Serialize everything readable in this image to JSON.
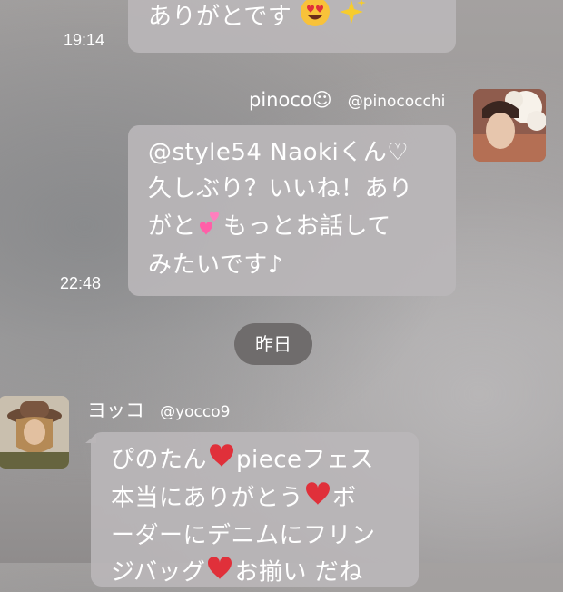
{
  "messages": [
    {
      "text_parts": [
        "ありがとです"
      ],
      "emojis": [
        "heart-eyes-emoji",
        "sparkles-emoji"
      ],
      "time": "19:14"
    },
    {
      "sender_name": "pinoco☺",
      "sender_handle": "@pinococchi",
      "lines": [
        "@style54 Naokiくん♡",
        "久しぶり？いいね！あり",
        "がと",
        "もっとお話して",
        "みたいです♪"
      ],
      "emojis": [
        "two-hearts-emoji"
      ],
      "time": "22:48"
    },
    {
      "sender_name": "ヨッコ",
      "sender_handle": "@yocco9",
      "lines": [
        "ぴのたん",
        "pieceフェス",
        "本当にありがとう",
        "ボ",
        "ーダーにデニムにフリン",
        "ジバッグ",
        "お揃い だね"
      ],
      "emojis": [
        "red-heart-emoji"
      ]
    }
  ],
  "date_separator": "昨日",
  "colors": {
    "bubble": "#bab6b8",
    "pill": "#6f6c6c",
    "text": "#ffffff",
    "heart": "#e0303a",
    "pink_heart": "#ff5fa8"
  }
}
